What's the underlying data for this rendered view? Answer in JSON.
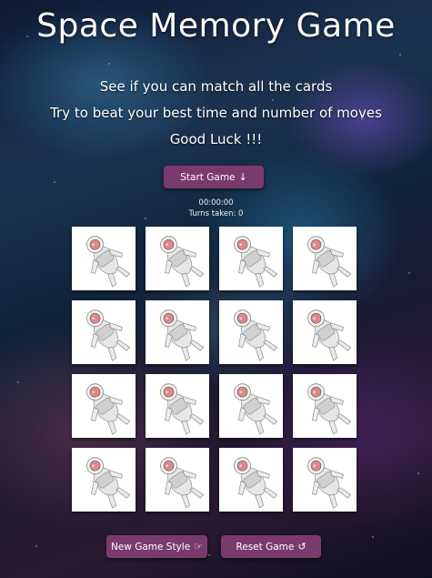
{
  "header": {
    "title": "Space Memory Game"
  },
  "intro": {
    "line1": "See if you can match all the cards",
    "line2": "Try to beat your best time and number of moves",
    "line3": "Good Luck !!!"
  },
  "controls": {
    "start_label": "Start Game",
    "start_icon": "arrow-down-icon",
    "new_style_label": "New Game Style",
    "new_style_icon": "hand-point-icon",
    "reset_label": "Reset Game",
    "reset_icon": "undo-icon",
    "button_color": "#7a3a6e"
  },
  "status": {
    "timer": "00:00:00",
    "turns": "Turns taken: 0"
  },
  "cards": [
    {
      "face": "astronaut"
    },
    {
      "face": "astronaut"
    },
    {
      "face": "astronaut"
    },
    {
      "face": "astronaut"
    },
    {
      "face": "astronaut"
    },
    {
      "face": "astronaut"
    },
    {
      "face": "astronaut"
    },
    {
      "face": "astronaut"
    },
    {
      "face": "astronaut"
    },
    {
      "face": "astronaut"
    },
    {
      "face": "astronaut"
    },
    {
      "face": "astronaut"
    },
    {
      "face": "astronaut"
    },
    {
      "face": "astronaut"
    },
    {
      "face": "astronaut"
    },
    {
      "face": "astronaut"
    }
  ]
}
